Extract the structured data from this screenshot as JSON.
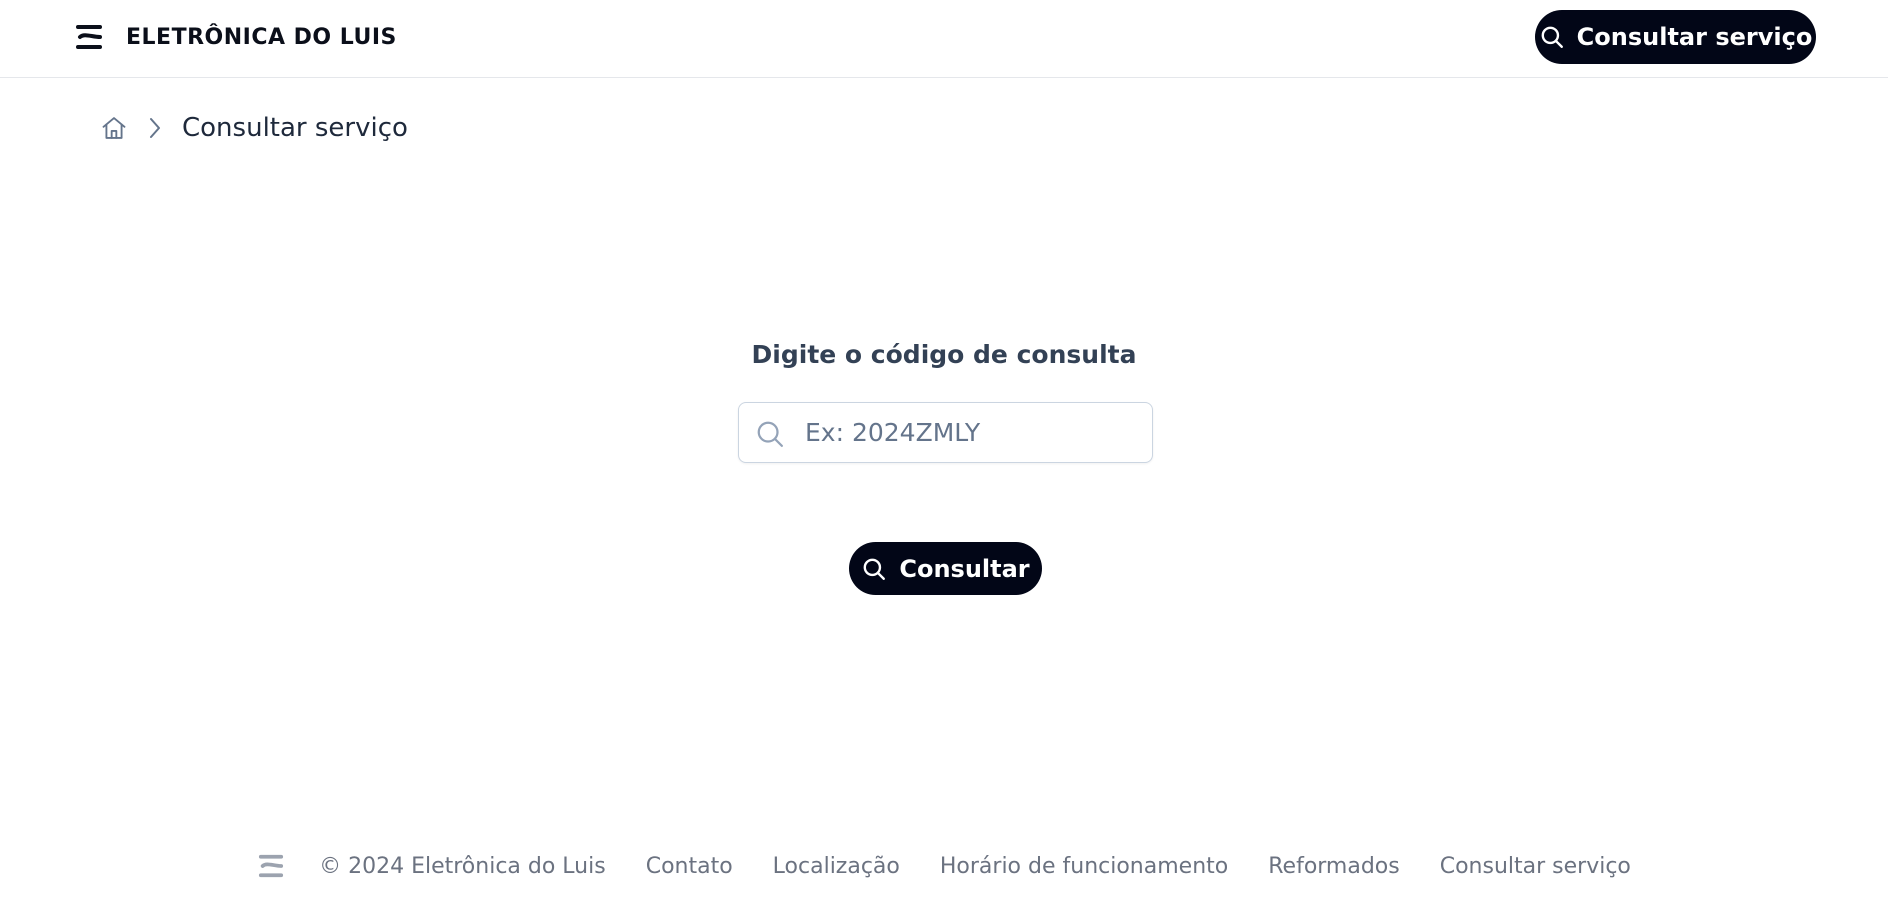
{
  "header": {
    "brand_name": "ELETRÔNICA DO LUIS",
    "brand_logo_icon": "brand-logo-icon",
    "cta_label": "Consultar serviço",
    "cta_icon": "search-icon"
  },
  "breadcrumb": {
    "home_icon": "home-icon",
    "separator_icon": "chevron-right-icon",
    "current": "Consultar serviço"
  },
  "form": {
    "title": "Digite o código de consulta",
    "input_placeholder": "Ex: 2024ZMLY",
    "input_value": "",
    "submit_label": "Consultar",
    "submit_icon": "search-icon"
  },
  "footer": {
    "copyright": "© 2024 Eletrônica do Luis",
    "links": [
      "Contato",
      "Localização",
      "Horário de funcionamento",
      "Reformados",
      "Consultar serviço"
    ]
  },
  "colors": {
    "primary": "#020617",
    "text_dark": "#1e293b",
    "text_muted": "#6b7280",
    "border": "#e5e7eb",
    "icon_muted": "#94a3b8"
  }
}
